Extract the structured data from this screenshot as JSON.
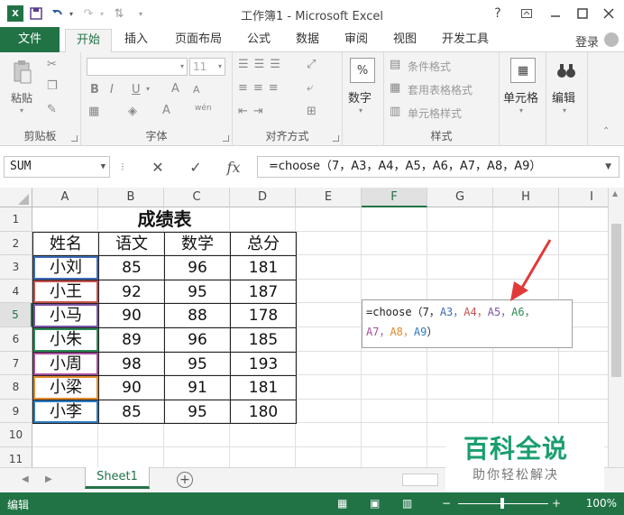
{
  "window": {
    "title": "工作簿1 - Microsoft Excel",
    "app_icon": "X",
    "help": "?",
    "controls": [
      "ribbon-display-icon",
      "minimize-icon",
      "maximize-icon",
      "close-icon"
    ]
  },
  "tabs": {
    "file": "文件",
    "items": [
      "开始",
      "插入",
      "页面布局",
      "公式",
      "数据",
      "审阅",
      "视图",
      "开发工具"
    ],
    "active_index": 0,
    "login": "登录"
  },
  "ribbon": {
    "clipboard": {
      "paste": "粘贴",
      "label": "剪贴板"
    },
    "font": {
      "size": "11",
      "bold": "B",
      "italic": "I",
      "underline": "U",
      "label": "字体",
      "grow": "A",
      "shrink": "A",
      "color": "A",
      "wen": "wén"
    },
    "align": {
      "label": "对齐方式"
    },
    "number": {
      "percent": "%",
      "label": "数字"
    },
    "styles": {
      "conditional": "条件格式",
      "table": "套用表格格式",
      "cell": "单元格样式",
      "label": "样式"
    },
    "cells": {
      "label": "单元格"
    },
    "editing": {
      "label": "编辑"
    }
  },
  "formula_bar": {
    "name_box": "SUM",
    "cancel": "✕",
    "enter": "✓",
    "fx": "fx",
    "formula": "=choose（7，A3，A4，A5，A6，A7，A8，A9）"
  },
  "columns": [
    "A",
    "B",
    "C",
    "D",
    "E",
    "F",
    "G",
    "H",
    "I"
  ],
  "selected_column": "F",
  "rows": [
    "1",
    "2",
    "3",
    "4",
    "5",
    "6",
    "7",
    "8",
    "9",
    "10",
    "11"
  ],
  "selected_row": "5",
  "table": {
    "title": "成绩表",
    "headers": [
      "姓名",
      "语文",
      "数学",
      "总分"
    ],
    "records": [
      {
        "name": "小刘",
        "chinese": "85",
        "math": "96",
        "total": "181",
        "ref_color": "#3f6bb8"
      },
      {
        "name": "小王",
        "chinese": "92",
        "math": "95",
        "total": "187",
        "ref_color": "#c8504c"
      },
      {
        "name": "小马",
        "chinese": "90",
        "math": "88",
        "total": "178",
        "ref_color": "#7a56a6"
      },
      {
        "name": "小朱",
        "chinese": "89",
        "math": "96",
        "total": "185",
        "ref_color": "#2e8b57"
      },
      {
        "name": "小周",
        "chinese": "98",
        "math": "95",
        "total": "193",
        "ref_color": "#a64e9b"
      },
      {
        "name": "小梁",
        "chinese": "90",
        "math": "91",
        "total": "181",
        "ref_color": "#e08a2e"
      },
      {
        "name": "小李",
        "chinese": "85",
        "math": "95",
        "total": "180",
        "ref_color": "#2b7bbf"
      }
    ]
  },
  "edit_cell": {
    "prefix": "=choose（7，",
    "refs": [
      {
        "text": "A3，",
        "color": "#3f6bb8"
      },
      {
        "text": "A4，",
        "color": "#c8504c"
      },
      {
        "text": "A5，",
        "color": "#7a56a6"
      },
      {
        "text": "A6，",
        "color": "#2e8b57"
      }
    ],
    "refs_line2": [
      {
        "text": "A7，",
        "color": "#a64e9b"
      },
      {
        "text": "A8，",
        "color": "#e08a2e"
      },
      {
        "text": "A9",
        "color": "#2b7bbf"
      }
    ],
    "suffix": "）"
  },
  "sheet_tabs": {
    "active": "Sheet1",
    "add": "+"
  },
  "status_bar": {
    "mode": "编辑",
    "zoom": "100%",
    "zoom_fraction": 0.5
  },
  "watermark": {
    "title": "百科全说",
    "subtitle": "助你轻松解决"
  },
  "colors": {
    "excel_green": "#217346",
    "arrow_red": "#e03a3a",
    "watermark_green": "#1a9e6e"
  }
}
